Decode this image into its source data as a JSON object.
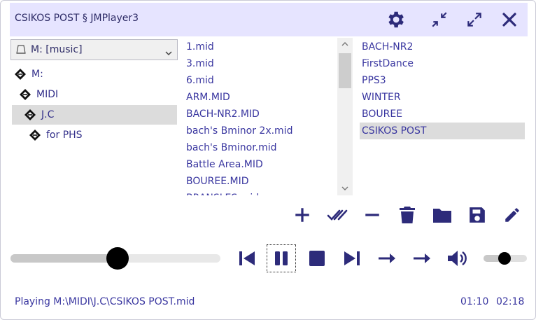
{
  "window": {
    "title": "CSIKOS POST § JMPlayer3"
  },
  "titlebar_buttons": [
    "gear-icon",
    "compress-icon",
    "expand-icon",
    "close-icon"
  ],
  "drive_select": {
    "value": "M: [music]"
  },
  "tree": {
    "items": [
      {
        "label": "M:",
        "depth": 0,
        "selected": false
      },
      {
        "label": "MIDI",
        "depth": 1,
        "selected": false
      },
      {
        "label": "J.C",
        "depth": 2,
        "selected": true
      },
      {
        "label": "for PHS",
        "depth": 3,
        "selected": false
      }
    ]
  },
  "files": {
    "items": [
      "1.mid",
      "3.mid",
      "6.mid",
      "ARM.MID",
      "BACH-NR2.MID",
      "bach's Bminor 2x.mid",
      "bach's Bminor.mid",
      "Battle Area.MID",
      "BOUREE.MID",
      "BRANSLES.mid"
    ]
  },
  "playlist": {
    "items": [
      "BACH-NR2",
      "FirstDance",
      "PPS3",
      "WINTER",
      "BOUREE",
      "CSIKOS POST"
    ],
    "selected_index": 5
  },
  "actions": [
    "add-icon",
    "select-all-icon",
    "remove-icon",
    "delete-icon",
    "open-folder-icon",
    "save-icon",
    "edit-icon"
  ],
  "transport": [
    "previous-icon",
    "pause-icon",
    "stop-icon",
    "next-icon",
    "arrow-right-icon",
    "arrow-right-icon",
    "volume-icon"
  ],
  "seek": {
    "position_fraction": 0.51
  },
  "volume": {
    "level_fraction": 0.48
  },
  "status": {
    "text": "Playing M:\\MIDI\\J.C\\CSIKOS POST.mid",
    "elapsed": "01:10",
    "total": "02:18"
  },
  "colors": {
    "accent": "#33308a",
    "titlebar_bg": "#e6e4ff",
    "selection_bg": "#dcdcdc"
  }
}
